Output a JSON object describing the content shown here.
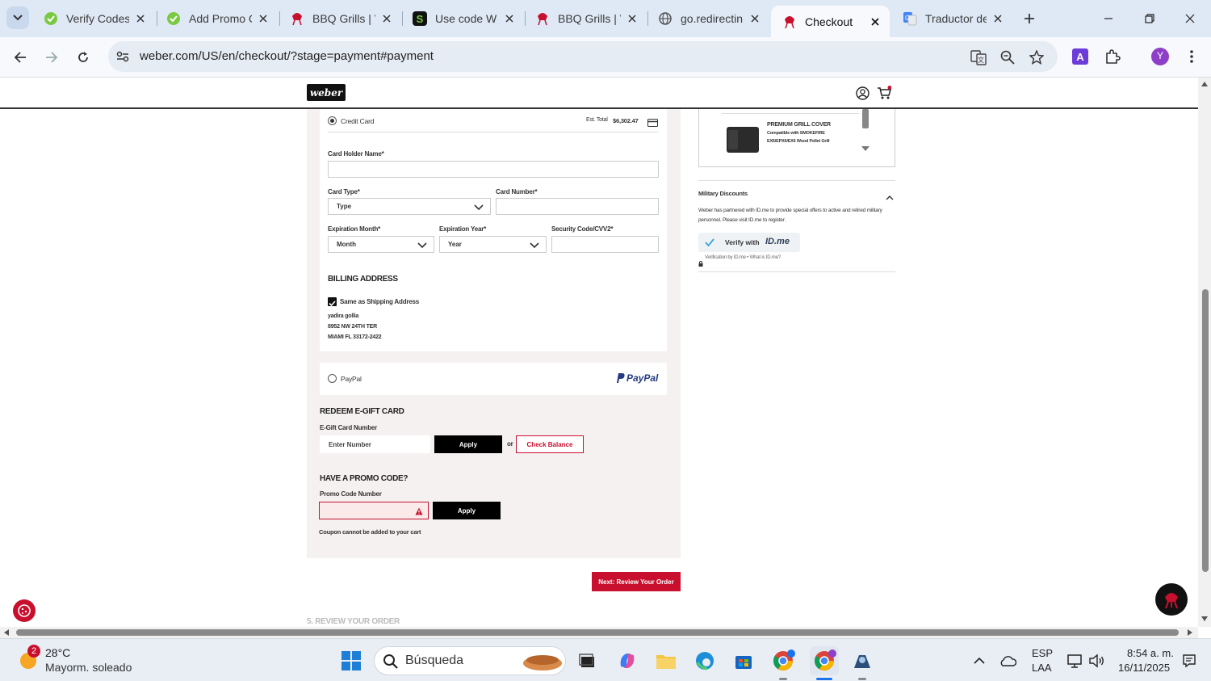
{
  "browser": {
    "tabs": [
      {
        "title": "Verify Codes",
        "icon": "promo-check-icon"
      },
      {
        "title": "Add Promo C",
        "icon": "promo-check-icon"
      },
      {
        "title": "BBQ Grills | V",
        "icon": "weber-kettle-icon"
      },
      {
        "title": "Use code W",
        "icon": "s-letter-icon"
      },
      {
        "title": "BBQ Grills | V",
        "icon": "weber-kettle-icon"
      },
      {
        "title": "go.redirectin",
        "icon": "globe-icon"
      },
      {
        "title": "Checkout",
        "icon": "weber-kettle-icon",
        "active": true
      },
      {
        "title": "Traductor de",
        "icon": "google-translate-icon"
      }
    ],
    "url": "weber.com/US/en/checkout/?stage=payment#payment",
    "profile_initial": "Y"
  },
  "header": {
    "logo_text": "weber"
  },
  "payment": {
    "credit_card_label": "Credit Card",
    "est_total_label": "Est. Total",
    "est_total_value": "$6,302.47",
    "card_holder_label": "Card Holder Name*",
    "card_type_label": "Card Type*",
    "card_type_value": "Type",
    "card_number_label": "Card Number*",
    "exp_month_label": "Expiration Month*",
    "exp_month_value": "Month",
    "exp_year_label": "Expiration Year*",
    "exp_year_value": "Year",
    "cvv_label": "Security Code/CVV2*",
    "billing_title": "BILLING ADDRESS",
    "same_as_shipping_label": "Same as Shipping Address",
    "same_as_shipping_checked": true,
    "address_lines": [
      "yadira gollia",
      "8952 NW 24TH TER",
      "MIAMI FL 33172-2422"
    ],
    "paypal_label": "PayPal",
    "paypal_logo": "PayPal"
  },
  "gift_card": {
    "title": "REDEEM E-GIFT CARD",
    "number_label": "E-Gift Card Number",
    "placeholder": "Enter Number",
    "apply_label": "Apply",
    "or_label": "or",
    "check_balance_label": "Check Balance"
  },
  "promo": {
    "title": "HAVE A PROMO CODE?",
    "number_label": "Promo Code Number",
    "apply_label": "Apply",
    "error_message": "Coupon cannot be added to your cart"
  },
  "next_button_label": "Next: Review Your Order",
  "next_step_label": "5. REVIEW YOUR ORDER",
  "summary": {
    "product_name": "PREMIUM GRILL COVER",
    "product_compat": "Compatible with SMOKEFIRE EX6/EPX6/EX6 Wood Pellet Grill"
  },
  "military": {
    "title": "Military Discounts",
    "description": "Weber has partnered with ID.me to provide special offers to active and retired military personnel. Please visit ID.me to register.",
    "verify_label": "Verify with",
    "idme_logo": "ID.me",
    "footnote": "Verification by ID.me • What is ID.me?"
  },
  "taskbar": {
    "weather_temp": "28°C",
    "weather_desc": "Mayorm. soleado",
    "weather_badge": "2",
    "search_placeholder": "Búsqueda",
    "lang_top": "ESP",
    "lang_bottom": "LAA",
    "time": "8:54 a. m.",
    "date": "16/11/2025"
  },
  "colors": {
    "weber_red": "#c8102e",
    "panel_bg": "#f5f1f0",
    "chrome_bg": "#dfe9f5"
  }
}
